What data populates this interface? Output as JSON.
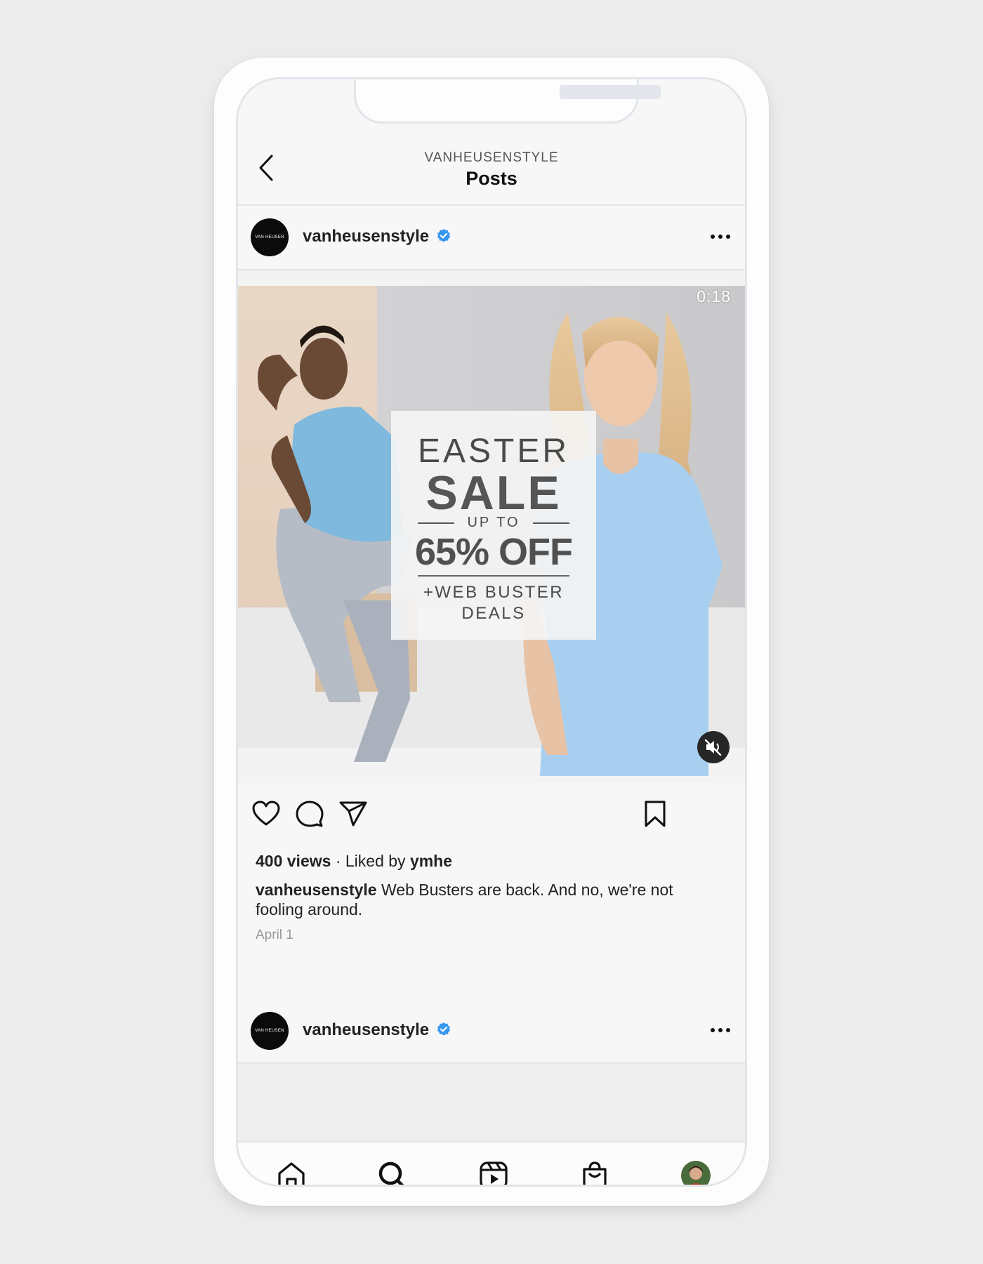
{
  "header": {
    "account": "VANHEUSENSTYLE",
    "title": "Posts"
  },
  "post": {
    "account": "vanheusenstyle",
    "avatar_text": "VAN HEUSEN",
    "duration": "0:18",
    "overlay": {
      "line1": "EASTER",
      "line2": "SALE",
      "line3": "UP TO",
      "line4": "65% OFF",
      "line5": "+WEB BUSTER",
      "line6": "DEALS"
    },
    "views": "400 views",
    "separator": "·",
    "liked_by_prefix": "Liked by",
    "liked_by_user": "ymhe",
    "caption_user": "vanheusenstyle",
    "caption_text": "Web Busters are back. And no, we're not fooling around.",
    "date": "April 1"
  },
  "next_post": {
    "account": "vanheusenstyle",
    "avatar_text": "VAN HEUSEN"
  },
  "colors": {
    "verified": "#3897f0",
    "text": "#222222",
    "muted": "#9a9a9a"
  },
  "icons": {
    "back": "chevron-left-icon",
    "more": "more-horizontal-icon",
    "verified": "verified-badge-icon",
    "like": "heart-icon",
    "comment": "comment-icon",
    "share": "send-icon",
    "save": "bookmark-icon",
    "mute": "speaker-muted-icon",
    "home": "home-icon",
    "search": "search-icon",
    "reels": "reels-icon",
    "shop": "shopping-bag-icon",
    "profile": "profile-avatar"
  }
}
